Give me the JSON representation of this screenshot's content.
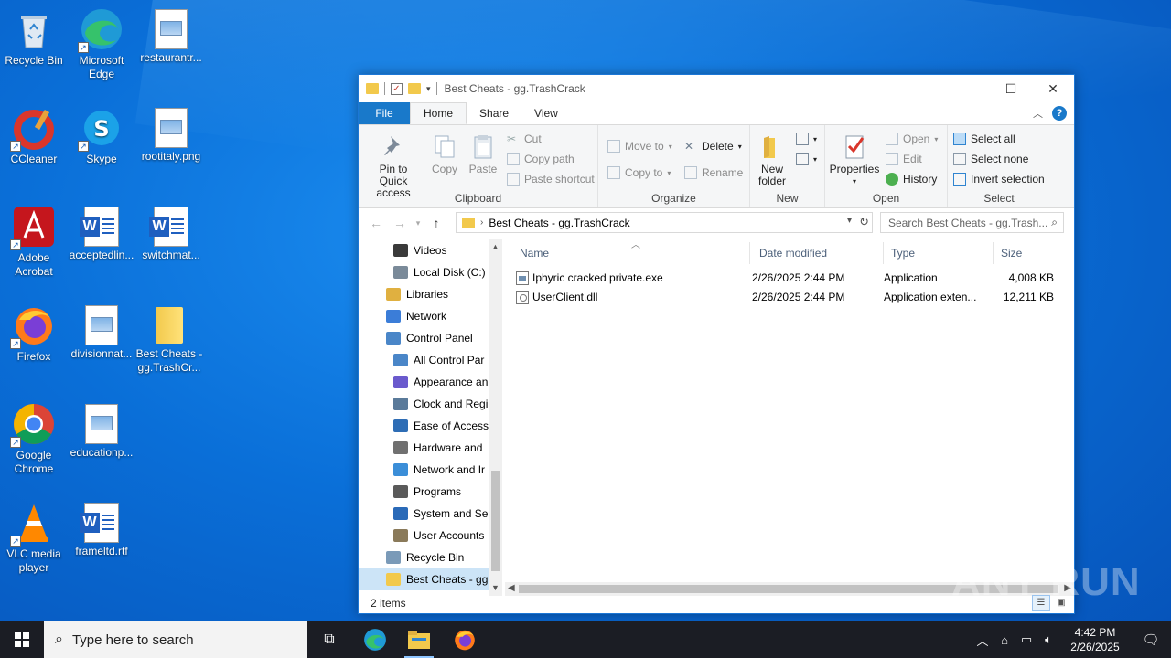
{
  "desktop": {
    "icons": [
      {
        "label": "Recycle Bin"
      },
      {
        "label": "Microsoft Edge"
      },
      {
        "label": "restaurantr..."
      },
      {
        "label": "CCleaner"
      },
      {
        "label": "Skype"
      },
      {
        "label": "rootitaly.png"
      },
      {
        "label": "Adobe Acrobat"
      },
      {
        "label": "acceptedlin..."
      },
      {
        "label": "switchmat..."
      },
      {
        "label": "Firefox"
      },
      {
        "label": "divisionnat..."
      },
      {
        "label": "Best Cheats - gg.TrashCr..."
      },
      {
        "label": "Google Chrome"
      },
      {
        "label": "educationp..."
      },
      {
        "label": "VLC media player"
      },
      {
        "label": "frameltd.rtf"
      }
    ],
    "watermark": "ANY RUN"
  },
  "window": {
    "title": "Best Cheats - gg.TrashCrack",
    "tabs": {
      "file": "File",
      "home": "Home",
      "share": "Share",
      "view": "View"
    },
    "ribbon": {
      "clipboard": {
        "title": "Clipboard",
        "pin": "Pin to Quick access",
        "copy": "Copy",
        "paste": "Paste",
        "cut": "Cut",
        "copy_path": "Copy path",
        "paste_shortcut": "Paste shortcut"
      },
      "organize": {
        "title": "Organize",
        "move_to": "Move to",
        "copy_to": "Copy to",
        "delete": "Delete",
        "rename": "Rename"
      },
      "new": {
        "title": "New",
        "new_folder": "New folder"
      },
      "open": {
        "title": "Open",
        "properties": "Properties",
        "open": "Open",
        "edit": "Edit",
        "history": "History"
      },
      "select": {
        "title": "Select",
        "select_all": "Select all",
        "select_none": "Select none",
        "invert": "Invert selection"
      }
    },
    "address": {
      "path": "Best Cheats - gg.TrashCrack",
      "search_placeholder": "Search Best Cheats - gg.Trash..."
    },
    "nav": [
      {
        "label": "Videos",
        "color": "#3a3a3a"
      },
      {
        "label": "Local Disk (C:)",
        "color": "#7a8a99"
      },
      {
        "label": "Libraries",
        "color": "#e0b040"
      },
      {
        "label": "Network",
        "color": "#3b7dd8"
      },
      {
        "label": "Control Panel",
        "color": "#4a86c8"
      },
      {
        "label": "All Control Par",
        "color": "#4a86c8"
      },
      {
        "label": "Appearance an",
        "color": "#6a5acd"
      },
      {
        "label": "Clock and Regi",
        "color": "#5a7a9a"
      },
      {
        "label": "Ease of Access",
        "color": "#2e6db5"
      },
      {
        "label": "Hardware and",
        "color": "#707070"
      },
      {
        "label": "Network and Ir",
        "color": "#3b8ed8"
      },
      {
        "label": "Programs",
        "color": "#5a5a5a"
      },
      {
        "label": "System and Se",
        "color": "#2a6ab8"
      },
      {
        "label": "User Accounts",
        "color": "#8a7a5a"
      },
      {
        "label": "Recycle Bin",
        "color": "#7a9ab8"
      },
      {
        "label": "Best Cheats - gg",
        "color": "#f2c94c"
      }
    ],
    "columns": {
      "name": "Name",
      "date": "Date modified",
      "type": "Type",
      "size": "Size"
    },
    "files": [
      {
        "name": "Iphyric cracked private.exe",
        "date": "2/26/2025 2:44 PM",
        "type": "Application",
        "size": "4,008 KB",
        "kind": "exe"
      },
      {
        "name": "UserClient.dll",
        "date": "2/26/2025 2:44 PM",
        "type": "Application exten...",
        "size": "12,211 KB",
        "kind": "dll"
      }
    ],
    "status": "2 items"
  },
  "taskbar": {
    "search_placeholder": "Type here to search",
    "time": "4:42 PM",
    "date": "2/26/2025"
  }
}
